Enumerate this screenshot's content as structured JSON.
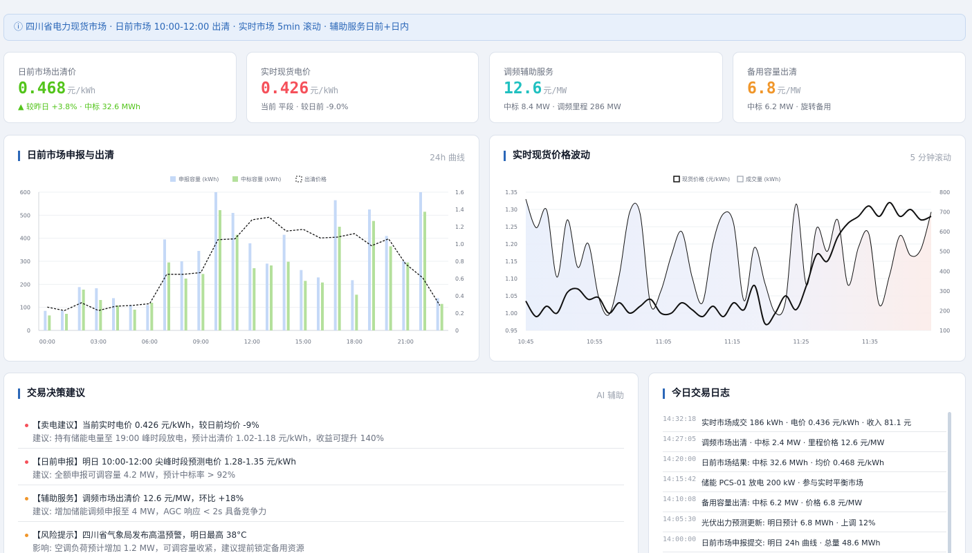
{
  "banner": {
    "icon": "info-icon",
    "text": "ⓘ 四川省电力现货市场 · 日前市场 10:00-12:00 出清 · 实时市场 5min 滚动 · 辅助服务日前+日内"
  },
  "kpis": [
    {
      "label": "日前市场出清价",
      "value": "0.468",
      "unit": "元/kWh",
      "sub": "▲ 较昨日 +3.8% · 中标 32.6 MWh",
      "color": "#52c41a",
      "sub_color": "#52c41a"
    },
    {
      "label": "实时现货电价",
      "value": "0.426",
      "unit": "元/kWh",
      "sub": "当前 平段 · 较日前 -9.0%",
      "color": "#f5505a",
      "sub_color": "#6b7280"
    },
    {
      "label": "调频辅助服务",
      "value": "12.6",
      "unit": "元/MW",
      "sub": "中标 8.4 MW · 调频里程 286 MW",
      "color": "#20c0c0",
      "sub_color": "#6b7280"
    },
    {
      "label": "备用容量出清",
      "value": "6.8",
      "unit": "元/MW",
      "sub": "中标 6.2 MW · 旋转备用",
      "color": "#f0962a",
      "sub_color": "#6b7280"
    }
  ],
  "panels": {
    "dayahead": {
      "title": "日前市场申报与出清",
      "tag": "24h 曲线"
    },
    "realtime": {
      "title": "实时现货价格波动",
      "tag": "5 分钟滚动"
    },
    "advice": {
      "title": "交易决策建议",
      "tag": "AI 辅助"
    },
    "log": {
      "title": "今日交易日志"
    }
  },
  "chart_data": [
    {
      "type": "bar",
      "legend": [
        "申报容量 (kWh)",
        "中标容量 (kWh)",
        "出清价格"
      ],
      "legend_placement": "top-center",
      "categories": [
        "00:00",
        "01:00",
        "02:00",
        "03:00",
        "04:00",
        "05:00",
        "06:00",
        "07:00",
        "08:00",
        "09:00",
        "10:00",
        "11:00",
        "12:00",
        "13:00",
        "14:00",
        "15:00",
        "16:00",
        "17:00",
        "18:00",
        "19:00",
        "20:00",
        "21:00",
        "22:00",
        "23:00"
      ],
      "x_tick_labels": [
        "00:00",
        "03:00",
        "06:00",
        "09:00",
        "12:00",
        "15:00",
        "18:00",
        "21:00"
      ],
      "y_left_ticks": [
        "0",
        "100",
        "200",
        "300",
        "400",
        "500",
        "600"
      ],
      "y_right_ticks": [
        "0",
        "0.2",
        "0.4",
        "0.6",
        "0.8",
        "1.0",
        "1.2",
        "1.4",
        "1.6"
      ],
      "ylim_left": [
        0,
        600
      ],
      "ylim_right": [
        0,
        1.6
      ],
      "grid": true,
      "series": [
        {
          "name": "申报容量 (kWh)",
          "axis": "left",
          "color": "#c5d9f7",
          "values": [
            85,
            85,
            188,
            183,
            140,
            110,
            110,
            395,
            300,
            345,
            600,
            510,
            378,
            290,
            415,
            262,
            230,
            565,
            218,
            525,
            410,
            300,
            600,
            140
          ]
        },
        {
          "name": "中标容量 (kWh)",
          "axis": "left",
          "color": "#b4e09c",
          "values": [
            65,
            72,
            177,
            132,
            108,
            90,
            120,
            295,
            225,
            245,
            522,
            415,
            270,
            282,
            298,
            215,
            208,
            450,
            155,
            475,
            365,
            295,
            515,
            115
          ]
        },
        {
          "name": "出清价格",
          "axis": "right",
          "color": "#111111",
          "values": [
            0.27,
            0.23,
            0.32,
            0.23,
            0.28,
            0.29,
            0.31,
            0.65,
            0.65,
            0.67,
            1.05,
            1.06,
            1.28,
            1.31,
            1.15,
            1.17,
            1.07,
            1.08,
            1.12,
            0.98,
            1.06,
            0.77,
            0.61,
            0.29
          ]
        }
      ]
    },
    {
      "type": "line",
      "legend": [
        "现货价格 (元/kWh)",
        "成交量 (kWh)"
      ],
      "legend_placement": "top-center",
      "x_tick_labels": [
        "10:45",
        "10:55",
        "11:05",
        "11:15",
        "11:25",
        "11:35"
      ],
      "y_left_ticks": [
        "0.95",
        "1.00",
        "1.05",
        "1.10",
        "1.15",
        "1.20",
        "1.25",
        "1.30",
        "1.35"
      ],
      "y_right_ticks": [
        "100",
        "200",
        "300",
        "400",
        "500",
        "600",
        "700",
        "800"
      ],
      "ylim_left": [
        0.95,
        1.35
      ],
      "ylim_right": [
        100,
        800
      ],
      "grid": true,
      "series": [
        {
          "name": "现货价格 (元/kWh)",
          "axis": "left",
          "color": "#111111",
          "values": [
            1.035,
            0.99,
            1.02,
            1.0,
            1.06,
            1.07,
            1.04,
            1.045,
            1.0,
            1.03,
            1.0,
            1.02,
            1.04,
            1.0,
            1.0,
            1.03,
            1.01,
            0.99,
            1.02,
            0.99,
            1.03,
            1.01,
            1.08,
            0.97,
            1.0,
            1.05,
            1.01,
            1.08,
            1.17,
            1.15,
            1.22,
            1.26,
            1.28,
            1.31,
            1.28,
            1.32,
            1.28,
            1.3,
            1.27,
            1.28
          ]
        },
        {
          "name": "成交量 (kWh)",
          "axis": "right",
          "color": "#111111",
          "values": [
            765,
            620,
            710,
            370,
            660,
            420,
            540,
            270,
            180,
            380,
            700,
            690,
            230,
            300,
            480,
            600,
            370,
            240,
            540,
            690,
            640,
            250,
            520,
            340,
            190,
            250,
            740,
            330,
            620,
            500,
            660,
            330,
            520,
            590,
            230,
            380,
            580,
            480,
            510,
            700
          ]
        }
      ]
    }
  ],
  "advice": [
    {
      "title": "【卖电建议】当前实时电价 0.426 元/kWh，较日前均价 -9%",
      "detail": "建议: 持有储能电量至 19:00 峰时段放电，预计出清价 1.02-1.18 元/kWh，收益可提升 140%",
      "dot_color": "#f5505a"
    },
    {
      "title": "【日前申报】明日 10:00-12:00 尖峰时段预测电价 1.28-1.35 元/kWh",
      "detail": "建议: 全额申报可调容量 4.2 MW，预计中标率 > 92%",
      "dot_color": "#f5505a"
    },
    {
      "title": "【辅助服务】调频市场出清价 12.6 元/MW，环比 +18%",
      "detail": "建议: 增加储能调频申报至 4 MW，AGC 响应 < 2s 具备竞争力",
      "dot_color": "#f0962a"
    },
    {
      "title": "【风险提示】四川省气象局发布高温预警，明日最高 38°C",
      "detail": "影响: 空调负荷预计增加 1.2 MW，可调容量收紧，建议提前锁定备用资源",
      "dot_color": "#f0962a"
    }
  ],
  "log": [
    {
      "time": "14:32:18",
      "text": "实时市场成交 186 kWh · 电价 0.436 元/kWh · 收入 81.1 元"
    },
    {
      "time": "14:27:05",
      "text": "调频市场出清 · 中标 2.4 MW · 里程价格 12.6 元/MW"
    },
    {
      "time": "14:20:00",
      "text": "日前市场结果: 中标 32.6 MWh · 均价 0.468 元/kWh"
    },
    {
      "time": "14:15:42",
      "text": "储能 PCS-01 放电 200 kW · 参与实时平衡市场"
    },
    {
      "time": "14:10:08",
      "text": "备用容量出清: 中标 6.2 MW · 价格 6.8 元/MW"
    },
    {
      "time": "14:05:30",
      "text": "光伏出力预测更新: 明日预计 6.8 MWh · 上调 12%"
    },
    {
      "time": "14:00:00",
      "text": "日前市场申报提交: 明日 24h 曲线 · 总量 48.6 MWh"
    }
  ]
}
